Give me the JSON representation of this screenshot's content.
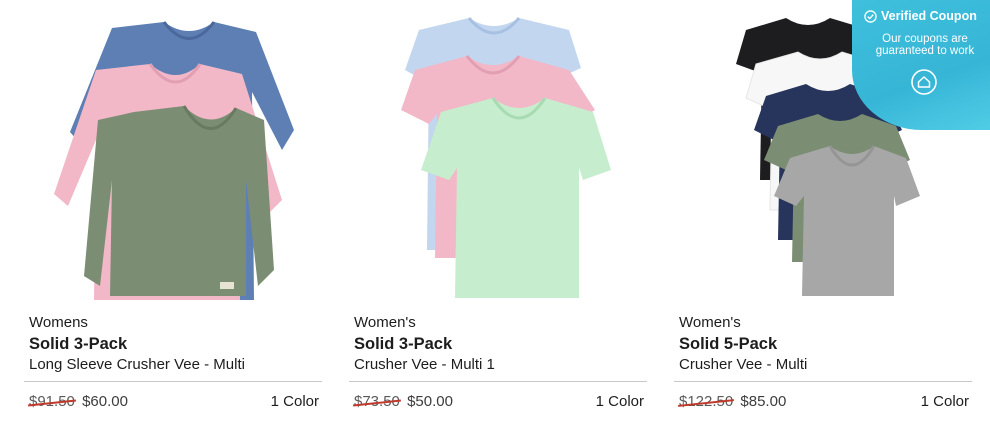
{
  "products": [
    {
      "gender": "Womens",
      "name": "Solid 3-Pack",
      "subtitle": "Long Sleeve Crusher Vee - Multi",
      "old_price": "$91.50",
      "price": "$60.00",
      "colors": "1 Color"
    },
    {
      "gender": "Women's",
      "name": "Solid 3-Pack",
      "subtitle": "Crusher Vee - Multi 1",
      "old_price": "$73.50",
      "price": "$50.00",
      "colors": "1 Color"
    },
    {
      "gender": "Women's",
      "name": "Solid 5-Pack",
      "subtitle": "Crusher Vee - Multi",
      "old_price": "$122.50",
      "price": "$85.00",
      "colors": "1 Color"
    }
  ],
  "coupon": {
    "title": "Verified Coupon",
    "text": "Our coupons are guaranteed to work",
    "check_icon": "check-circle-icon",
    "home_icon": "home-icon"
  },
  "shirt_colors": {
    "blue": "#5e7fb4",
    "pink": "#f2b8c8",
    "sage": "#7b8e73",
    "light_blue": "#c2d6ef",
    "mint": "#c6edcd",
    "black": "#1d1d20",
    "white": "#f7f7f7",
    "navy": "#27345b",
    "gray": "#a7a7a7"
  }
}
